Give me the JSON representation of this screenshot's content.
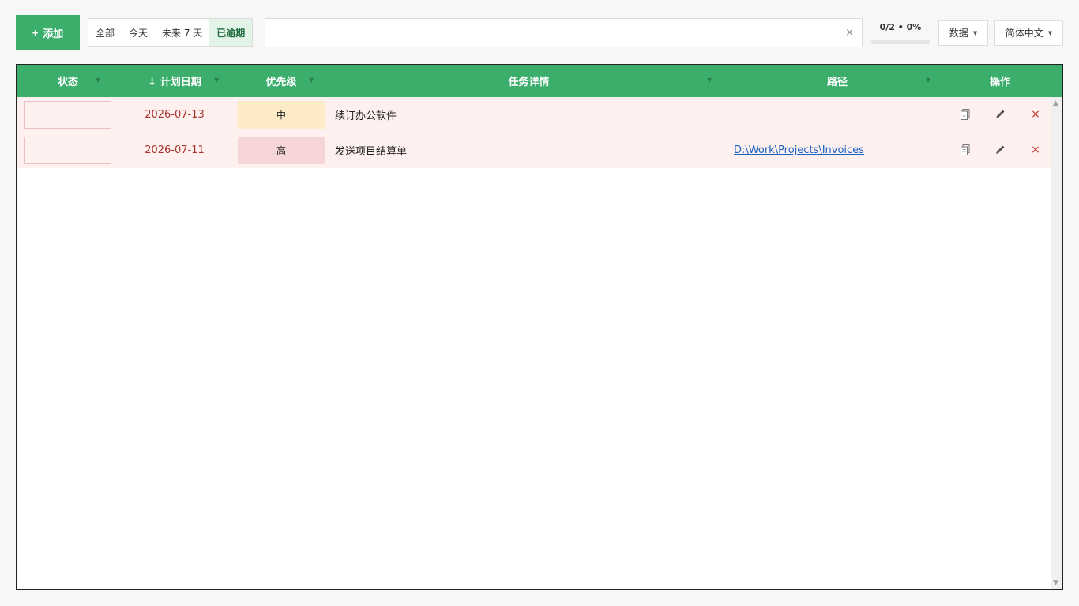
{
  "toolbar": {
    "add_label": "添加",
    "add_icon": "plus-icon",
    "filters": [
      "全部",
      "今天",
      "未来 7 天",
      "已逾期"
    ],
    "active_filter_index": 3,
    "search": {
      "value": "",
      "placeholder": "",
      "clear_label": "×"
    },
    "progress": {
      "label": "0/2 • 0%",
      "done": 0,
      "total": 2,
      "percent": 0
    },
    "data_menu_label": "数据",
    "language_label": "简体中文"
  },
  "table": {
    "columns": {
      "status": "状态",
      "date": "↓ 计划日期",
      "priority": "优先级",
      "detail": "任务详情",
      "path": "路径",
      "actions": "操作"
    },
    "rows": [
      {
        "date": "2026-07-13",
        "priority": "中",
        "priority_color": "#fdebc8",
        "detail": "续订办公软件",
        "path": ""
      },
      {
        "date": "2026-07-11",
        "priority": "高",
        "priority_color": "#f6d5d6",
        "detail": "发送项目结算单",
        "path": "D:\\Work\\Projects\\Invoices"
      }
    ]
  },
  "colors": {
    "accent": "#3cae6c",
    "overdue_row_bg": "#fdf0ef",
    "overdue_date": "#a7332c",
    "link": "#1d63c4",
    "delete": "#c8332c"
  }
}
